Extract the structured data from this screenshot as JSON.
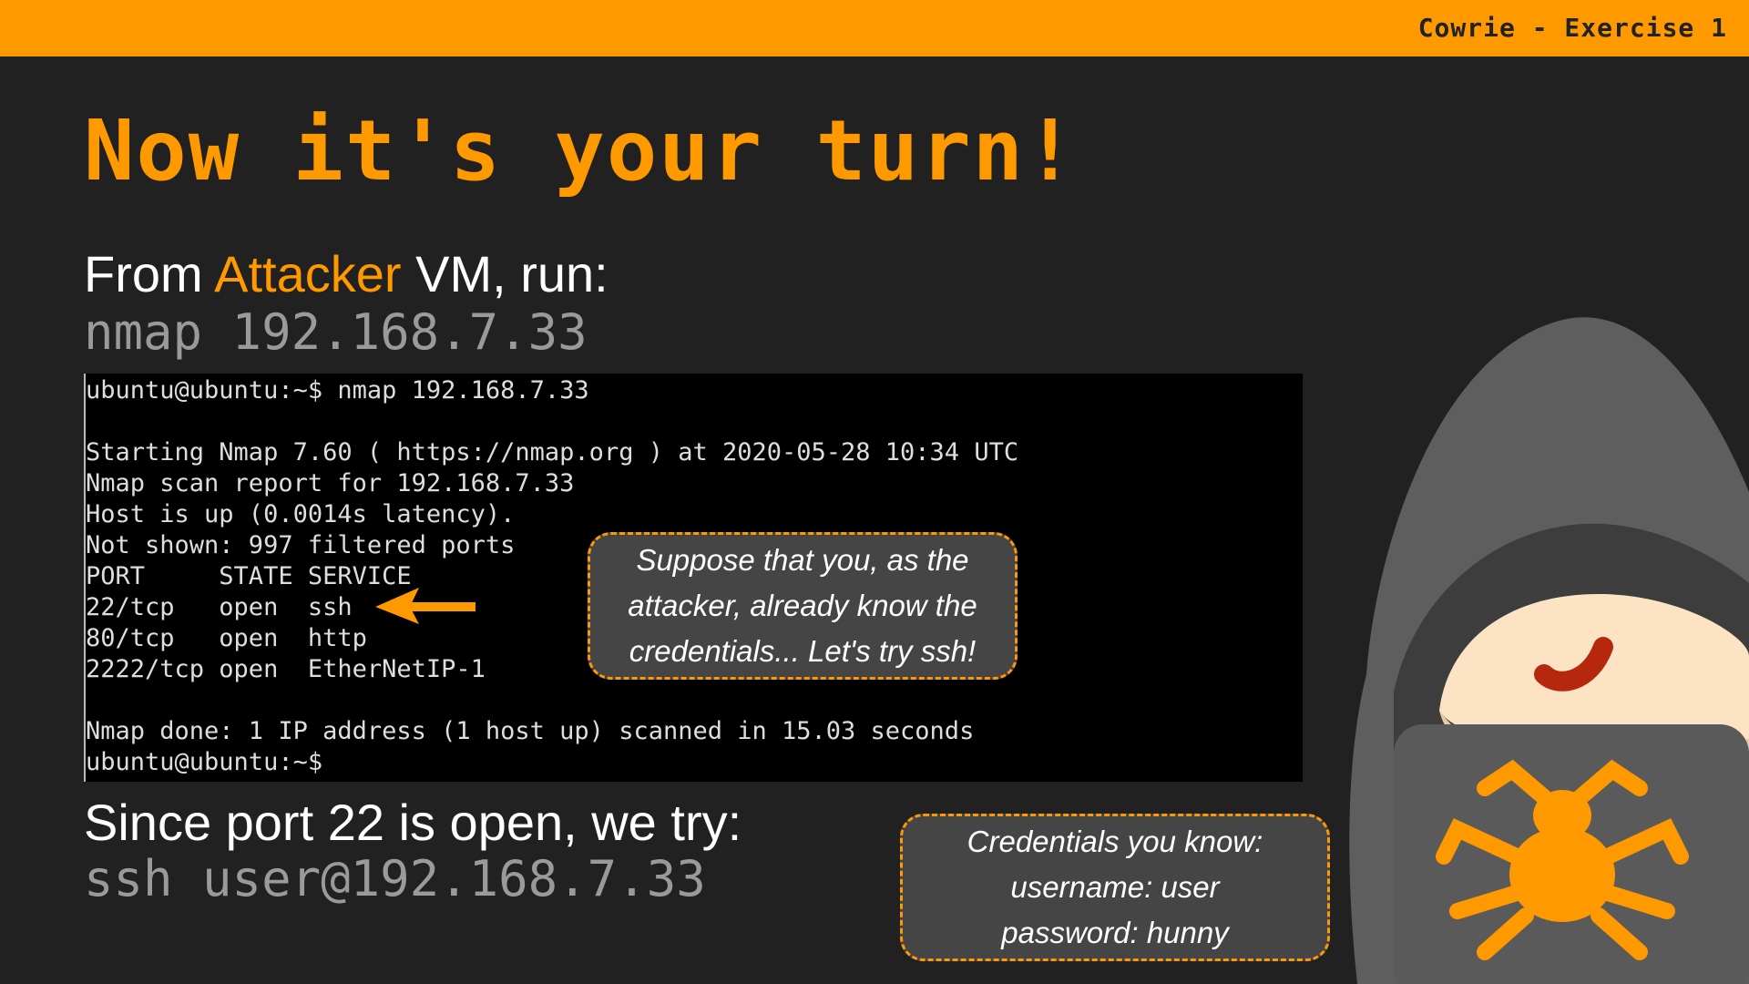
{
  "header": {
    "label": "Cowrie - Exercise 1"
  },
  "title": "Now it's your turn!",
  "step1": {
    "prefix": "From ",
    "highlight": "Attacker",
    "suffix": " VM, run:",
    "command": "nmap 192.168.7.33"
  },
  "terminal": {
    "lines": [
      "ubuntu@ubuntu:~$ nmap 192.168.7.33",
      "",
      "Starting Nmap 7.60 ( https://nmap.org ) at 2020-05-28 10:34 UTC",
      "Nmap scan report for 192.168.7.33",
      "Host is up (0.0014s latency).",
      "Not shown: 997 filtered ports",
      "PORT     STATE SERVICE",
      "22/tcp   open  ssh",
      "80/tcp   open  http",
      "2222/tcp open  EtherNetIP-1",
      "",
      "Nmap done: 1 IP address (1 host up) scanned in 15.03 seconds",
      "ubuntu@ubuntu:~$"
    ]
  },
  "note1": {
    "lines": [
      "Suppose that you, as the",
      "attacker, already know the",
      "credentials... Let's try ssh!"
    ]
  },
  "step2": {
    "text": "Since port 22 is open, we try:",
    "command": "ssh user@192.168.7.33"
  },
  "note2": {
    "lines": [
      "Credentials you know:",
      "username: user",
      "password: hunny"
    ]
  },
  "colors": {
    "accent": "#ff9900",
    "background": "#212121",
    "terminal": "#000000",
    "bubble": "#454545"
  },
  "icons": {
    "arrow": "arrow-left-icon",
    "mascot": "hooded-hacker-icon",
    "logo": "spider-icon"
  }
}
